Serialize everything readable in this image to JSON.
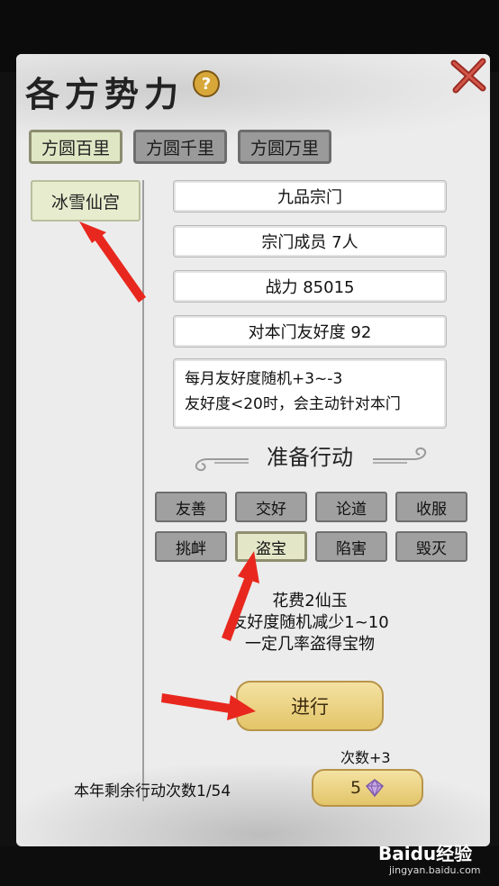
{
  "dialog": {
    "title": "各方势力",
    "help_symbol": "?",
    "tabs": [
      {
        "label": "方圆百里",
        "active": true
      },
      {
        "label": "方圆千里",
        "active": false
      },
      {
        "label": "方圆万里",
        "active": false
      }
    ],
    "sidebar": {
      "items": [
        {
          "label": "冰雪仙宫",
          "selected": true
        }
      ]
    },
    "info": {
      "rank": "九品宗门",
      "members": "宗门成员 7人",
      "power": "战力 85015",
      "friendship": "对本门友好度 92",
      "desc_line1": "每月友好度随机+3~-3",
      "desc_line2": "友好度<20时，会主动针对本门"
    },
    "action_section_title": "准备行动",
    "actions": [
      {
        "label": "友善",
        "selected": false
      },
      {
        "label": "交好",
        "selected": false
      },
      {
        "label": "论道",
        "selected": false
      },
      {
        "label": "收服",
        "selected": false
      },
      {
        "label": "挑衅",
        "selected": false
      },
      {
        "label": "盗宝",
        "selected": true
      },
      {
        "label": "陷害",
        "selected": false
      },
      {
        "label": "毁灭",
        "selected": false
      }
    ],
    "cost": {
      "line1": "花费2仙玉",
      "line2": "友好度随机减少1~10",
      "line3": "一定几率盗得宝物"
    },
    "proceed_label": "进行",
    "extra": {
      "label": "次数+3",
      "value": "5"
    },
    "remaining": "本年剩余行动次数1/54"
  },
  "watermark": {
    "brand": "Baidu经验",
    "url": "jingyan.baidu.com"
  },
  "colors": {
    "arrow": "#e8281e",
    "gold": "#e3c569",
    "selected": "#e3e7c8"
  }
}
